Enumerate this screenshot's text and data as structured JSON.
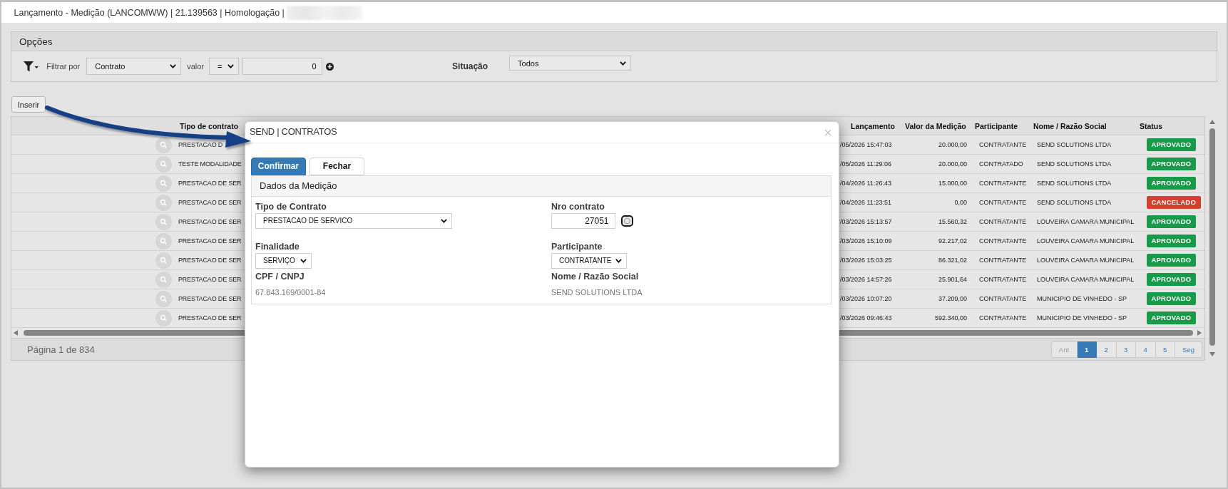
{
  "window": {
    "title": "Lançamento - Medição (LANCOMWW) | 21.139563 | Homologação |"
  },
  "options": {
    "title": "Opções",
    "filter": {
      "label": "Filtrar por",
      "field": "Contrato",
      "value_label": "valor",
      "operator": "=",
      "value": "0"
    },
    "status": {
      "label": "Situação",
      "value": "Todos"
    }
  },
  "insert_button": {
    "label": "Inserir"
  },
  "table": {
    "columns": [
      "Tipo de contrato",
      "Lançamento",
      "Valor da Medição",
      "Participante",
      "Nome / Razão Social",
      "Status"
    ],
    "rows": [
      {
        "tipo_de_contrato": "PRESTACAO D",
        "lancamento": "/05/2026 15:47:03",
        "valor_da_medicao": "20.000,00",
        "participante": "CONTRATANTE",
        "nome_razao_social": "SEND SOLUTIONS LTDA",
        "status": "APROVADO",
        "color": "#189b48"
      },
      {
        "tipo_de_contrato": "TESTE MODALIDADE",
        "lancamento": "/05/2026 11:29:06",
        "valor_da_medicao": "20.000,00",
        "participante": "CONTRATADO",
        "nome_razao_social": "SEND SOLUTIONS LTDA",
        "status": "APROVADO",
        "color": "#189b48"
      },
      {
        "tipo_de_contrato": "PRESTACAO DE SER",
        "lancamento": "/04/2026 11:26:43",
        "valor_da_medicao": "15.000,00",
        "participante": "CONTRATANTE",
        "nome_razao_social": "SEND SOLUTIONS LTDA",
        "status": "APROVADO",
        "color": "#189b48"
      },
      {
        "tipo_de_contrato": "PRESTACAO DE SER",
        "lancamento": "/04/2026 11:23:51",
        "valor_da_medicao": "0,00",
        "participante": "CONTRATANTE",
        "nome_razao_social": "SEND SOLUTIONS LTDA",
        "status": "CANCELADO",
        "color": "#d4402e"
      },
      {
        "tipo_de_contrato": "PRESTACAO DE SER",
        "lancamento": "/03/2026 15:13:57",
        "valor_da_medicao": "15.560,32",
        "participante": "CONTRATANTE",
        "nome_razao_social": "LOUVEIRA CAMARA MUNICIPAL",
        "status": "APROVADO",
        "color": "#189b48"
      },
      {
        "tipo_de_contrato": "PRESTACAO DE SER",
        "lancamento": "/03/2026 15:10:09",
        "valor_da_medicao": "92.217,02",
        "participante": "CONTRATANTE",
        "nome_razao_social": "LOUVEIRA CAMARA MUNICIPAL",
        "status": "APROVADO",
        "color": "#189b48"
      },
      {
        "tipo_de_contrato": "PRESTACAO DE SER",
        "lancamento": "/03/2026 15:03:25",
        "valor_da_medicao": "86.321,02",
        "participante": "CONTRATANTE",
        "nome_razao_social": "LOUVEIRA CAMARA MUNICIPAL",
        "status": "APROVADO",
        "color": "#189b48"
      },
      {
        "tipo_de_contrato": "PRESTACAO DE SER",
        "lancamento": "/03/2026 14:57:26",
        "valor_da_medicao": "25.901,64",
        "participante": "CONTRATANTE",
        "nome_razao_social": "LOUVEIRA CAMARA MUNICIPAL",
        "status": "APROVADO",
        "color": "#189b48"
      },
      {
        "tipo_de_contrato": "PRESTACAO DE SER",
        "lancamento": "/03/2026 10:07:20",
        "valor_da_medicao": "37.209,00",
        "participante": "CONTRATANTE",
        "nome_razao_social": "MUNICIPIO DE VINHEDO - SP",
        "status": "APROVADO",
        "color": "#189b48"
      },
      {
        "tipo_de_contrato": "PRESTACAO DE SER",
        "lancamento": "/03/2026 09:46:43",
        "valor_da_medicao": "592.340,00",
        "participante": "CONTRATANTE",
        "nome_razao_social": "MUNICIPIO DE VINHEDO - SP",
        "status": "APROVADO",
        "color": "#189b48"
      }
    ]
  },
  "pagination": {
    "summary": "Página 1 de 834",
    "pages": [
      {
        "label": "Ant",
        "kind": "previous",
        "selected": false,
        "disabled": true
      },
      {
        "label": "1",
        "kind": "page",
        "selected": true,
        "disabled": false
      },
      {
        "label": "2",
        "kind": "page",
        "selected": false,
        "disabled": false
      },
      {
        "label": "3",
        "kind": "page",
        "selected": false,
        "disabled": false
      },
      {
        "label": "4",
        "kind": "page",
        "selected": false,
        "disabled": false
      },
      {
        "label": "5",
        "kind": "page",
        "selected": false,
        "disabled": false
      },
      {
        "label": "Seg",
        "kind": "next",
        "selected": false,
        "disabled": false
      }
    ]
  },
  "modal": {
    "title": "SEND | CONTRATOS",
    "close": "×",
    "buttons": [
      {
        "label": "Confirmar",
        "kind": "primary"
      },
      {
        "label": "Fechar",
        "kind": "secondary"
      }
    ],
    "section": {
      "title": "Dados da Medição",
      "fields": [
        {
          "label": "Tipo de Contrato",
          "kind": "select",
          "value": "PRESTACAO DE SERVICO"
        },
        {
          "label": "Nro contrato",
          "kind": "lookup",
          "value": "27051"
        },
        {
          "label": "Finalidade",
          "kind": "select",
          "value": "SERVIÇO"
        },
        {
          "label": "Participante",
          "kind": "select",
          "value": "CONTRATANTE"
        },
        {
          "label": "CPF / CNPJ",
          "kind": "readonly",
          "value": "67.843.169/0001-84"
        },
        {
          "label": "Nome / Razão Social",
          "kind": "readonly",
          "value": "SEND SOLUTIONS LTDA"
        }
      ]
    }
  }
}
